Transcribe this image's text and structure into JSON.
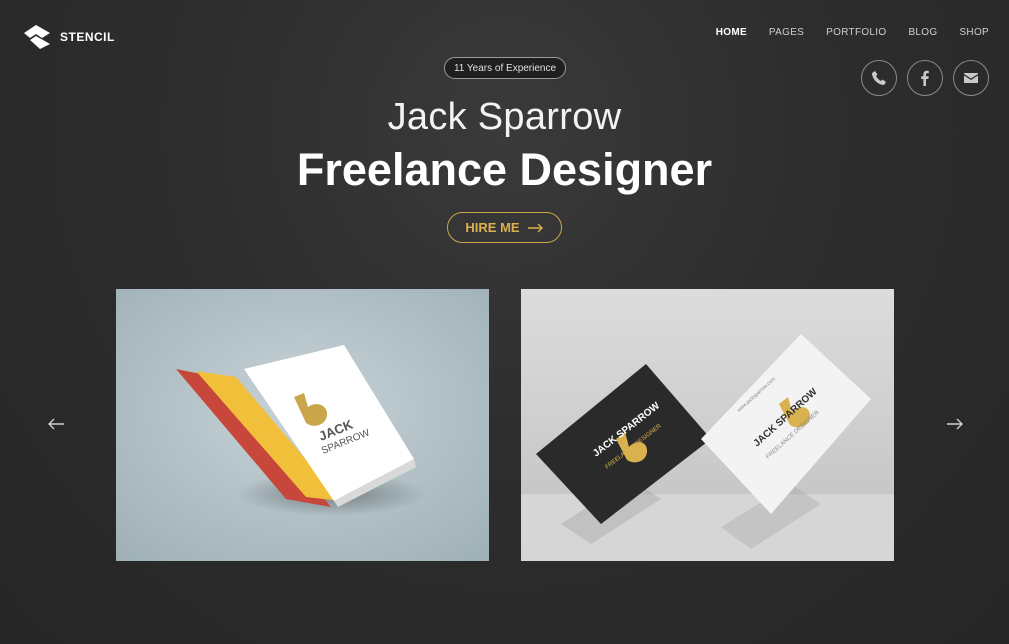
{
  "brand": {
    "name": "STENCIL"
  },
  "nav": {
    "items": [
      {
        "label": "HOME",
        "active": true
      },
      {
        "label": "PAGES",
        "active": false
      },
      {
        "label": "PORTFOLIO",
        "active": false
      },
      {
        "label": "BLOG",
        "active": false
      },
      {
        "label": "SHOP",
        "active": false
      }
    ]
  },
  "social": {
    "icons": [
      "phone-icon",
      "facebook-icon",
      "envelope-icon"
    ]
  },
  "hero": {
    "badge": "11 Years of Experience",
    "name": "Jack Sparrow",
    "role": "Freelance Designer",
    "cta": "HIRE ME"
  },
  "mockups": {
    "book": {
      "line1": "JACK",
      "line2": "SPARROW"
    },
    "cards": {
      "name": "JACK SPARROW",
      "role": "FREELANCE DESIGNER",
      "url": "www.jacksparrow.com"
    }
  },
  "colors": {
    "accent": "#d9b14e",
    "background": "#2d2d2d"
  }
}
